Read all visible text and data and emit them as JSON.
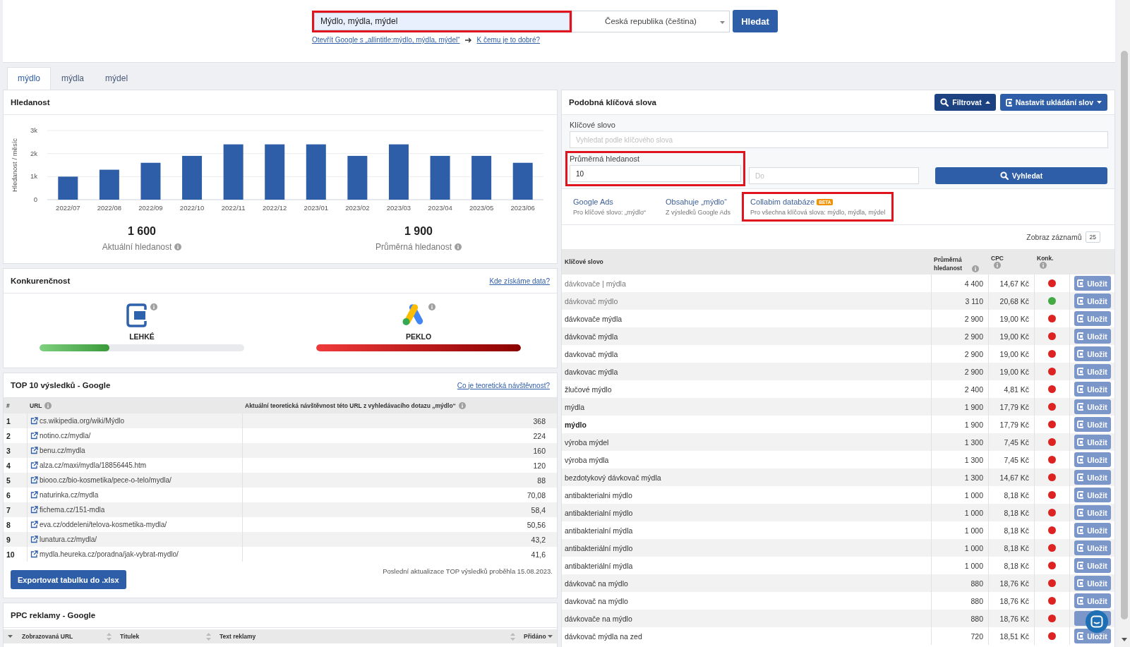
{
  "search": {
    "query": {
      "value": "Mýdlo, mýdla, mýdel",
      "highlighted": true
    },
    "country": "Česká republika (čeština)",
    "button": "Hledat",
    "google_link": "Otevřít Google s „allintitle:mýdlo, mýdla, mýdel“",
    "help_link": "K čemu je to dobré?"
  },
  "keyword_tabs": [
    {
      "label": "mýdlo",
      "selected": true
    },
    {
      "label": "mýdla",
      "selected": false
    },
    {
      "label": "mýdel",
      "selected": false
    }
  ],
  "volume": {
    "title": "Hledanost",
    "chart_data": {
      "type": "bar",
      "ylabel": "Hledanost / měsíc",
      "categories": [
        "2022/07",
        "2022/08",
        "2022/09",
        "2022/10",
        "2022/11",
        "2022/12",
        "2023/01",
        "2023/02",
        "2023/03",
        "2023/04",
        "2023/05",
        "2023/06"
      ],
      "values": [
        1000,
        1300,
        1600,
        1900,
        2400,
        2400,
        2400,
        1900,
        2400,
        1900,
        1900,
        1600
      ],
      "ylim": [
        0,
        3000
      ],
      "yticks": [
        {
          "value": 0,
          "label": "0"
        },
        {
          "value": 1000,
          "label": "1k"
        },
        {
          "value": 2000,
          "label": "2k"
        },
        {
          "value": 3000,
          "label": "3k"
        }
      ]
    },
    "stats": [
      {
        "value": "1 600",
        "label": "Aktuální hledanost"
      },
      {
        "value": "1 900",
        "label": "Průměrná hledanost"
      }
    ]
  },
  "competition": {
    "title": "Konkurenčnost",
    "link": "Kde získáme data?",
    "items": [
      {
        "kind": "collabim",
        "label": "LEHKÉ",
        "level": 0.34
      },
      {
        "kind": "google_ads",
        "label": "PEKLO",
        "level": 1
      }
    ]
  },
  "top_results": {
    "title": "TOP 10 výsledků - Google",
    "link": "Co je teoretická návštěvnost?",
    "columns": [
      {
        "label": "#",
        "info": false
      },
      {
        "label": "URL",
        "info": true
      },
      {
        "label": "Aktuální teoretická návštěvnost této URL z vyhledávacího dotazu „mýdlo“",
        "info": true
      }
    ],
    "rows": [
      {
        "rank": "1",
        "url": "cs.wikipedia.org/wiki/Mýdlo",
        "visits": "368"
      },
      {
        "rank": "2",
        "url": "notino.cz/mydla/",
        "visits": "224"
      },
      {
        "rank": "3",
        "url": "benu.cz/mydla",
        "visits": "160"
      },
      {
        "rank": "4",
        "url": "alza.cz/maxi/mydla/18856445.htm",
        "visits": "120"
      },
      {
        "rank": "5",
        "url": "biooo.cz/bio-kosmetika/pece-o-telo/mydla/",
        "visits": "88"
      },
      {
        "rank": "6",
        "url": "naturinka.cz/mydla",
        "visits": "70,08"
      },
      {
        "rank": "7",
        "url": "fichema.cz/151-mdla",
        "visits": "58,4"
      },
      {
        "rank": "8",
        "url": "eva.cz/oddeleni/telova-kosmetika-mydla/",
        "visits": "50,56"
      },
      {
        "rank": "9",
        "url": "lunatura.cz/mydla/",
        "visits": "43,2"
      },
      {
        "rank": "10",
        "url": "mydla.heureka.cz/poradna/jak-vybrat-mydlo/",
        "visits": "41,6"
      }
    ],
    "updated": "Poslední aktualizace TOP výsledků proběhla 15.08.2023.",
    "export_button": "Exportovat tabulku do .xlsx"
  },
  "ppc": {
    "title": "PPC reklamy - Google",
    "columns": [
      "Zobrazovaná URL",
      "Titulek",
      "Text reklamy",
      "Přidáno"
    ]
  },
  "similar": {
    "title": "Podobná klíčová slova",
    "filter_button": "Filtrovat",
    "save_settings_button": "Nastavit ukládání slov",
    "filter": {
      "keyword_label": "Klíčové slovo",
      "keyword_placeholder": "Vyhledat podle klíčového slova",
      "volume_label": "Průměrná hledanost",
      "volume_from": "10",
      "volume_to_placeholder": "Do",
      "volume_highlighted": true,
      "search_button": "Vyhledat"
    },
    "sources": [
      {
        "title": "Google Ads",
        "subtitle": "Pro klíčové slovo: „mýdlo“",
        "highlighted": false
      },
      {
        "title": "Obsahuje „mýdlo“",
        "subtitle": "Z výsledků Google Ads",
        "highlighted": false
      },
      {
        "title": "Collabim databáze",
        "badge": "BETA",
        "subtitle": "Pro všechna klíčová slova: mýdlo, mýdla, mýdel",
        "highlighted": true
      }
    ],
    "page_size_label": "Zobraz záznamů",
    "page_size": "25",
    "columns": [
      {
        "label": "Klíčové slovo",
        "info": false
      },
      {
        "label": "Průměrná hledanost",
        "info": true
      },
      {
        "label": "CPC",
        "info": true
      },
      {
        "label": "Konk.",
        "info": true
      }
    ],
    "rows": [
      {
        "keyword": "dávkovače | mýdla",
        "kind": "faded",
        "volume": "4 400",
        "cpc": "14,67 Kč",
        "color": "#dd2222",
        "save": "Uložit"
      },
      {
        "keyword": "dávkovač mýdlo",
        "kind": "faded",
        "volume": "3 110",
        "cpc": "20,68 Kč",
        "color": "#44aa44",
        "save": "Uložit"
      },
      {
        "keyword": "dávkovače mýdla",
        "kind": "plain",
        "volume": "2 900",
        "cpc": "19,00 Kč",
        "color": "#dd2222",
        "save": "Uložit"
      },
      {
        "keyword": "dávkovač mýdla",
        "kind": "plain",
        "volume": "2 900",
        "cpc": "19,00 Kč",
        "color": "#dd2222",
        "save": "Uložit"
      },
      {
        "keyword": "davkovač mýdla",
        "kind": "plain",
        "volume": "2 900",
        "cpc": "19,00 Kč",
        "color": "#dd2222",
        "save": "Uložit"
      },
      {
        "keyword": "davkovac mýdla",
        "kind": "plain",
        "volume": "2 900",
        "cpc": "19,00 Kč",
        "color": "#dd2222",
        "save": "Uložit"
      },
      {
        "keyword": "žlučové mýdlo",
        "kind": "plain",
        "volume": "2 400",
        "cpc": "4,81 Kč",
        "color": "#dd2222",
        "save": "Uložit"
      },
      {
        "keyword": "mýdla",
        "kind": "plain",
        "volume": "1 900",
        "cpc": "17,79 Kč",
        "color": "#dd2222",
        "save": "Uložit"
      },
      {
        "keyword": "mýdlo",
        "kind": "exact",
        "volume": "1 900",
        "cpc": "17,79 Kč",
        "color": "#dd2222",
        "save": "Uložit"
      },
      {
        "keyword": "výroba mýdel",
        "kind": "plain",
        "volume": "1 300",
        "cpc": "7,45 Kč",
        "color": "#dd2222",
        "save": "Uložit"
      },
      {
        "keyword": "výroba mýdla",
        "kind": "plain",
        "volume": "1 300",
        "cpc": "7,45 Kč",
        "color": "#dd2222",
        "save": "Uložit"
      },
      {
        "keyword": "bezdotykový dávkovač mýdla",
        "kind": "plain",
        "volume": "1 300",
        "cpc": "14,67 Kč",
        "color": "#dd2222",
        "save": "Uložit"
      },
      {
        "keyword": "antibakterialni mýdlo",
        "kind": "plain",
        "volume": "1 000",
        "cpc": "8,18 Kč",
        "color": "#dd2222",
        "save": "Uložit"
      },
      {
        "keyword": "antibakterialní mýdlo",
        "kind": "plain",
        "volume": "1 000",
        "cpc": "8,18 Kč",
        "color": "#dd2222",
        "save": "Uložit"
      },
      {
        "keyword": "antibakterialní mýdla",
        "kind": "plain",
        "volume": "1 000",
        "cpc": "8,18 Kč",
        "color": "#dd2222",
        "save": "Uložit"
      },
      {
        "keyword": "antibakteriální mýdlo",
        "kind": "plain",
        "volume": "1 000",
        "cpc": "8,18 Kč",
        "color": "#dd2222",
        "save": "Uložit"
      },
      {
        "keyword": "antibakteriální mýdla",
        "kind": "plain",
        "volume": "1 000",
        "cpc": "8,18 Kč",
        "color": "#dd2222",
        "save": "Uložit"
      },
      {
        "keyword": "dávkovač na mýdlo",
        "kind": "plain",
        "volume": "880",
        "cpc": "18,76 Kč",
        "color": "#dd2222",
        "save": "Uložit"
      },
      {
        "keyword": "davkovač na mýdlo",
        "kind": "plain",
        "volume": "880",
        "cpc": "18,76 Kč",
        "color": "#dd2222",
        "save": "Uložit"
      },
      {
        "keyword": "dávkovače na mýdlo",
        "kind": "plain",
        "volume": "880",
        "cpc": "18,76 Kč",
        "color": "#dd2222"
      },
      {
        "keyword": "dávkovač mýdla na zed",
        "kind": "plain",
        "volume": "720",
        "cpc": "18,51 Kč",
        "color": "#dd2222",
        "save": "Uložit"
      }
    ]
  }
}
